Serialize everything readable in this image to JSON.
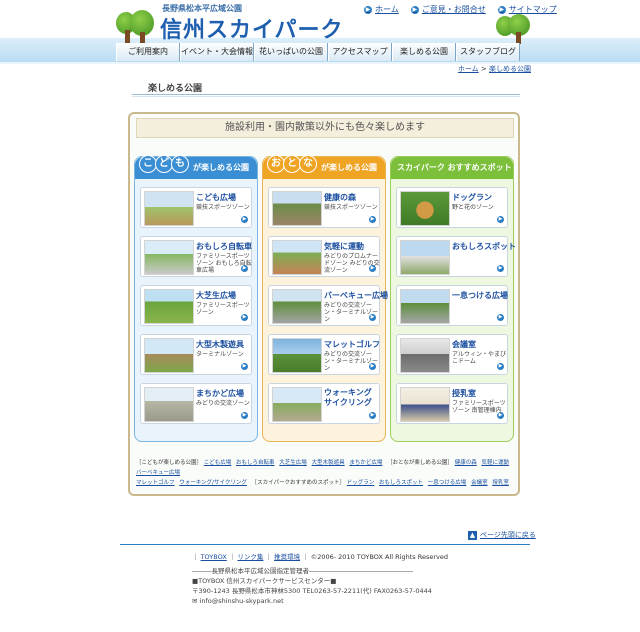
{
  "header": {
    "sub": "長野県松本平広域公園",
    "title": "信州スカイパーク",
    "toplinks": [
      "ホーム",
      "ご意見・お問合せ",
      "サイトマップ"
    ]
  },
  "nav": [
    "ご利用案内",
    "イベント・大会情報",
    "花いっぱいの公園",
    "アクセスマップ",
    "楽しめる公園",
    "スタッフブログ"
  ],
  "breadcrumb": {
    "home": "ホーム",
    "sep": ">",
    "current": "楽しめる公園"
  },
  "page_title": "楽しめる公園",
  "banner": "施設利用・園内散策以外にも色々楽しめます",
  "columns": [
    {
      "bubbles": [
        "こ",
        "ど",
        "も"
      ],
      "title": "が楽しめる公園",
      "cards": [
        {
          "title": "こども広場",
          "sub": "競技スポーツゾーン"
        },
        {
          "title": "おもしろ自転車",
          "sub": "ファミリースポーツゾーン おもしろ自転車広場"
        },
        {
          "title": "大芝生広場",
          "sub": "ファミリースポーツゾーン"
        },
        {
          "title": "大型木製遊具",
          "sub": "ターミナルゾーン"
        },
        {
          "title": "まちかど広場",
          "sub": "みどりの交流ゾーン"
        }
      ]
    },
    {
      "bubbles": [
        "お",
        "と",
        "な"
      ],
      "title": "が楽しめる公園",
      "cards": [
        {
          "title": "健康の森",
          "sub": "競技スポーツゾーン"
        },
        {
          "title": "気軽に運動",
          "sub": "みどりのプロムナードゾーン みどりの交流ゾーン"
        },
        {
          "title": "バーベキュー広場",
          "sub": "みどりの交流ゾーン・ターミナルゾーン"
        },
        {
          "title": "マレットゴルフ",
          "sub": "みどりの交流ゾーン・ターミナルゾーン"
        },
        {
          "title": "ウォーキング サイクリング",
          "sub": ""
        }
      ]
    },
    {
      "bubbles": [],
      "title": "スカイパーク おすすめスポット",
      "cards": [
        {
          "title": "ドッグラン",
          "sub": "野と花のゾーン"
        },
        {
          "title": "おもしろスポット",
          "sub": ""
        },
        {
          "title": "一息つける広場",
          "sub": ""
        },
        {
          "title": "会議室",
          "sub": "アルウィン・やまびこドーム"
        },
        {
          "title": "授乳室",
          "sub": "ファミリースポーツゾーン 南管理棟内"
        }
      ]
    }
  ],
  "links_text": {
    "l1_label": "［こどもが楽しめる公園］",
    "l1": [
      "こども広場",
      "おもしろ自転車",
      "大芝生広場",
      "大型木製遊具",
      "まちかど広場"
    ],
    "l2_label": "［おとなが楽しめる公園］",
    "l2": [
      "健康の森",
      "気軽に運動",
      "バーベキュー広場",
      "マレットゴルフ",
      "ウォーキング/サイクリング"
    ],
    "l3_label": "［スカイパークおすすめのスポット］",
    "l3": [
      "ドッグラン",
      "おもしろスポット",
      "一息つける広場",
      "会議室",
      "授乳室"
    ]
  },
  "pagetop": "ページ先頭に戻る",
  "footer": {
    "links": [
      "TOYBOX",
      "リンク集",
      "推奨環境"
    ],
    "copyright": "©2006- 2010 TOYBOX All Rights Reserved",
    "lines": [
      "―――長野県松本平広域公園指定管理者――――――――――――――――",
      "■TOYBOX 信州スカイパークサービスセンター■",
      "〒390-1243 長野県松本市神林5300 TEL0263-57-2211(代) FAX0263-57-0444",
      "✉ info@shinshu-skypark.net"
    ]
  },
  "colors": {
    "blue": "#3a8fd4",
    "orange": "#f0a424",
    "green": "#7cbf3a"
  }
}
